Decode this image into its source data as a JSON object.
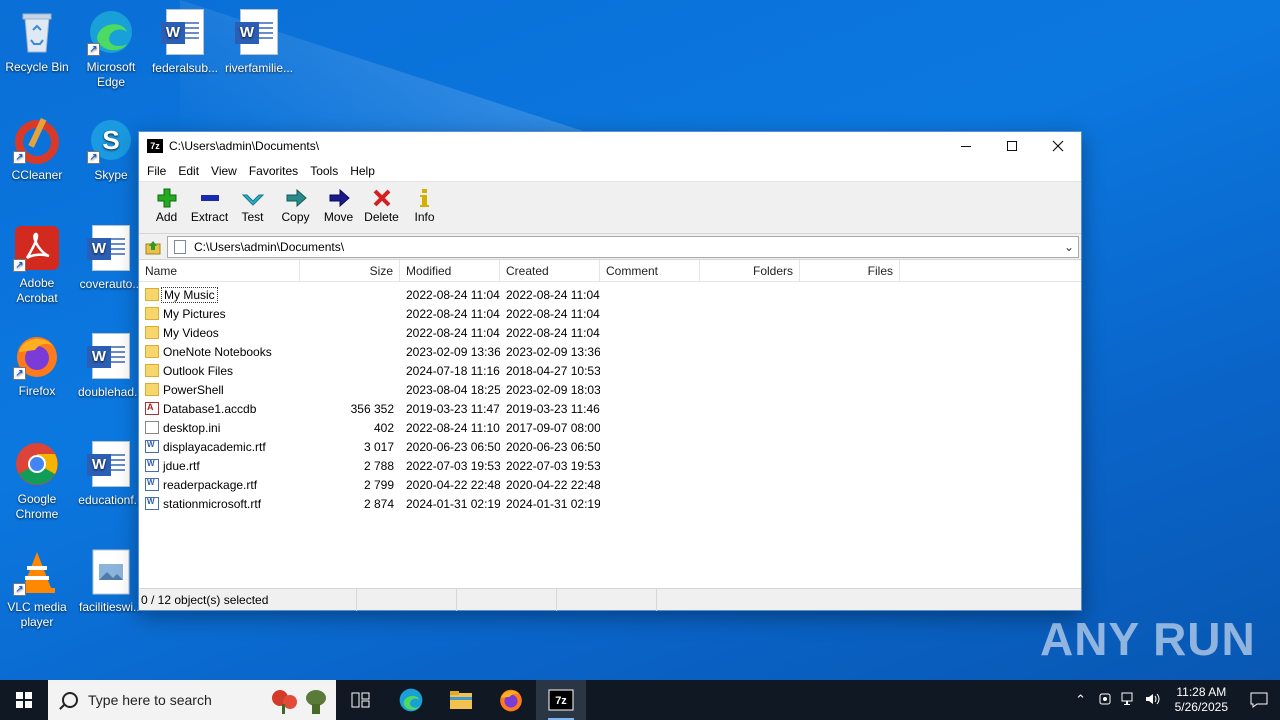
{
  "desktop": {
    "icons": [
      {
        "label": "Recycle Bin",
        "icon": "recycle-bin-icon"
      },
      {
        "label": "Microsoft Edge",
        "icon": "edge-icon"
      },
      {
        "label": "federalsub...",
        "icon": "word-doc-icon"
      },
      {
        "label": "riverfamilie...",
        "icon": "word-doc-icon"
      },
      {
        "label": "CCleaner",
        "icon": "ccleaner-icon"
      },
      {
        "label": "Skype",
        "icon": "skype-icon"
      },
      {
        "label": "Adobe Acrobat",
        "icon": "acrobat-icon"
      },
      {
        "label": "coverauto...",
        "icon": "word-doc-icon"
      },
      {
        "label": "Firefox",
        "icon": "firefox-icon"
      },
      {
        "label": "doublehad...",
        "icon": "word-doc-icon"
      },
      {
        "label": "Google Chrome",
        "icon": "chrome-icon"
      },
      {
        "label": "educationf...",
        "icon": "word-doc-icon"
      },
      {
        "label": "VLC media player",
        "icon": "vlc-icon"
      },
      {
        "label": "facilitieswi...",
        "icon": "image-file-icon"
      }
    ]
  },
  "window": {
    "title": "C:\\Users\\admin\\Documents\\",
    "app_icon_text": "7z",
    "menu": [
      "File",
      "Edit",
      "View",
      "Favorites",
      "Tools",
      "Help"
    ],
    "toolbar": [
      {
        "label": "Add",
        "icon": "add-icon",
        "color": "#22aa22"
      },
      {
        "label": "Extract",
        "icon": "extract-icon",
        "color": "#1a2ab0"
      },
      {
        "label": "Test",
        "icon": "test-icon",
        "color": "#2ab0c8"
      },
      {
        "label": "Copy",
        "icon": "copy-icon",
        "color": "#2a8a8a"
      },
      {
        "label": "Move",
        "icon": "move-icon",
        "color": "#1a1a8a"
      },
      {
        "label": "Delete",
        "icon": "delete-icon",
        "color": "#d42020"
      },
      {
        "label": "Info",
        "icon": "info-icon",
        "color": "#d4b000"
      }
    ],
    "address": "C:\\Users\\admin\\Documents\\",
    "columns": [
      "Name",
      "Size",
      "Modified",
      "Created",
      "Comment",
      "Folders",
      "Files"
    ],
    "rows": [
      {
        "name": "My Music",
        "type": "folder",
        "size": "",
        "modified": "2022-08-24 11:04",
        "created": "2022-08-24 11:04"
      },
      {
        "name": "My Pictures",
        "type": "folder",
        "size": "",
        "modified": "2022-08-24 11:04",
        "created": "2022-08-24 11:04"
      },
      {
        "name": "My Videos",
        "type": "folder",
        "size": "",
        "modified": "2022-08-24 11:04",
        "created": "2022-08-24 11:04"
      },
      {
        "name": "OneNote Notebooks",
        "type": "folder",
        "size": "",
        "modified": "2023-02-09 13:36",
        "created": "2023-02-09 13:36"
      },
      {
        "name": "Outlook Files",
        "type": "folder",
        "size": "",
        "modified": "2024-07-18 11:16",
        "created": "2018-04-27 10:53"
      },
      {
        "name": "PowerShell",
        "type": "folder",
        "size": "",
        "modified": "2023-08-04 18:25",
        "created": "2023-02-09 18:03"
      },
      {
        "name": "Database1.accdb",
        "type": "accdb",
        "size": "356 352",
        "modified": "2019-03-23 11:47",
        "created": "2019-03-23 11:46"
      },
      {
        "name": "desktop.ini",
        "type": "ini",
        "size": "402",
        "modified": "2022-08-24 11:10",
        "created": "2017-09-07 08:00"
      },
      {
        "name": "displayacademic.rtf",
        "type": "rtf",
        "size": "3 017",
        "modified": "2020-06-23 06:50",
        "created": "2020-06-23 06:50"
      },
      {
        "name": "jdue.rtf",
        "type": "rtf",
        "size": "2 788",
        "modified": "2022-07-03 19:53",
        "created": "2022-07-03 19:53"
      },
      {
        "name": "readerpackage.rtf",
        "type": "rtf",
        "size": "2 799",
        "modified": "2020-04-22 22:48",
        "created": "2020-04-22 22:48"
      },
      {
        "name": "stationmicrosoft.rtf",
        "type": "rtf",
        "size": "2 874",
        "modified": "2024-01-31 02:19",
        "created": "2024-01-31 02:19"
      }
    ],
    "status": "0 / 12 object(s) selected"
  },
  "watermark": "ANY RUN",
  "taskbar": {
    "search_placeholder": "Type here to search",
    "time": "11:28 AM",
    "date": "5/26/2025",
    "pinned": [
      "task-view-icon",
      "edge-icon",
      "file-explorer-icon",
      "firefox-icon",
      "7zip-icon"
    ],
    "seven_zip_label": "7z"
  }
}
